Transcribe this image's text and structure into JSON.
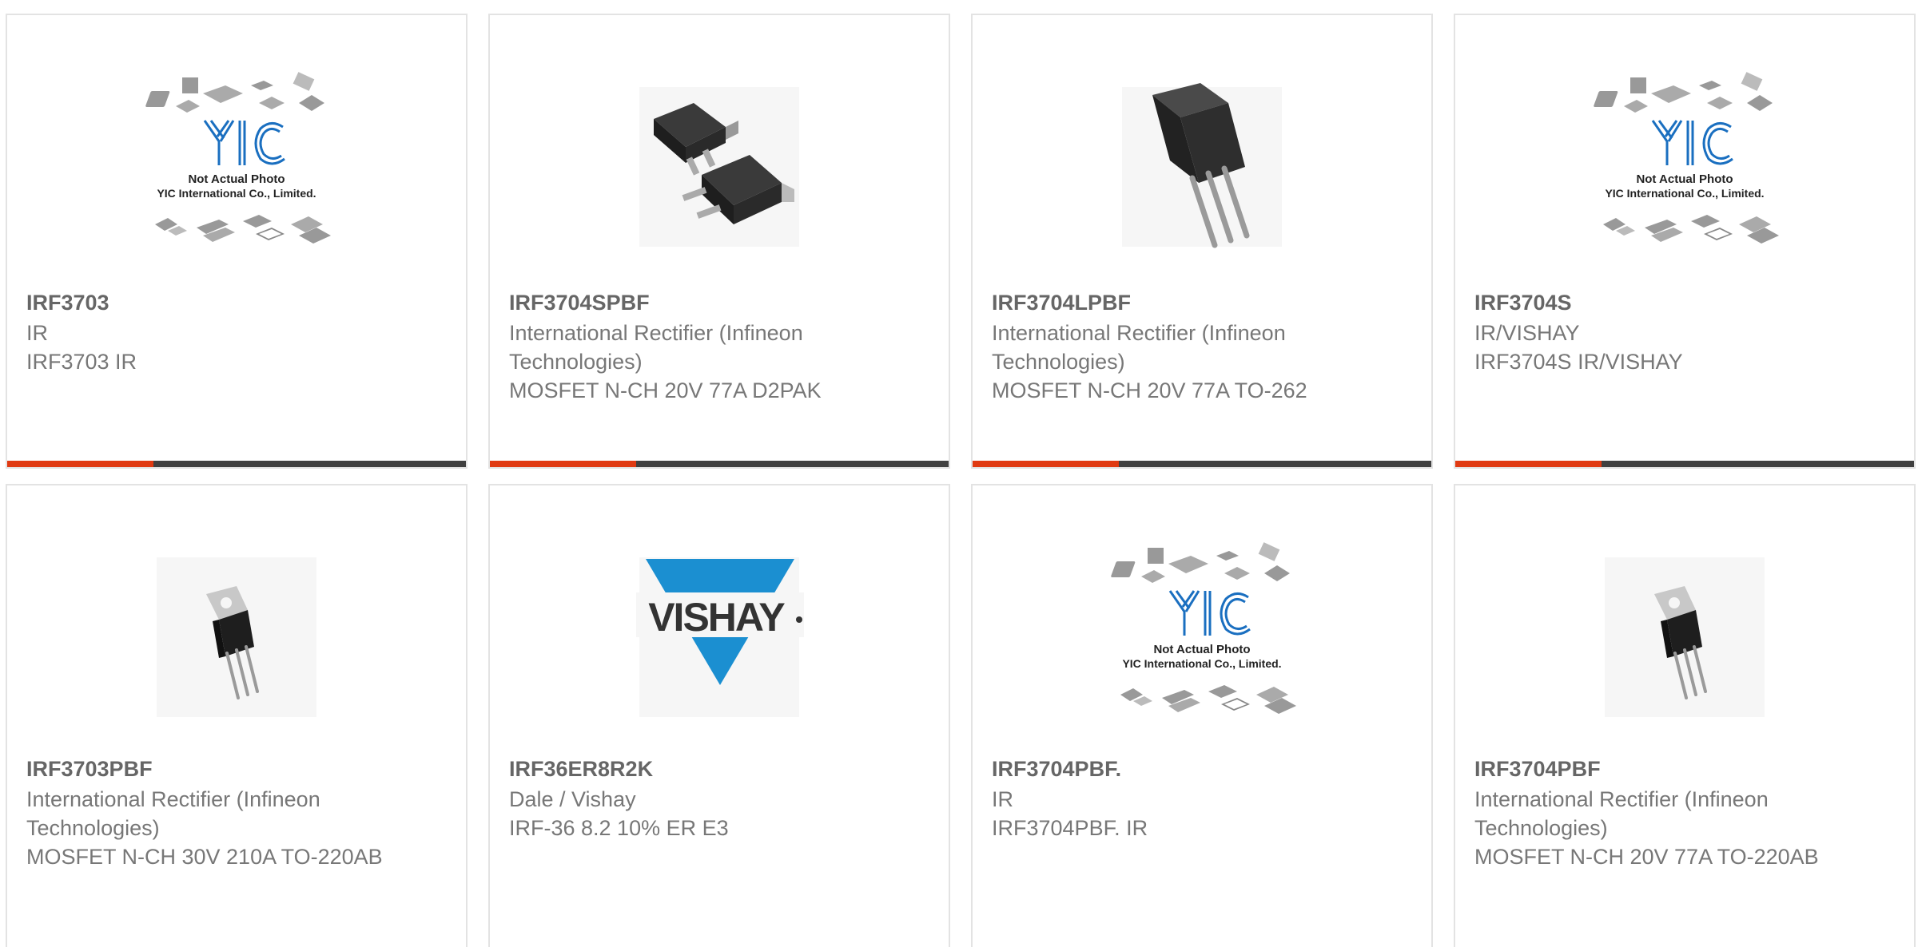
{
  "placeholder": {
    "line1": "Not Actual Photo",
    "line2": "YIC International Co., Limited."
  },
  "vishay_logo_text": "VISHAY",
  "colors": {
    "accent": "#e03a12",
    "bar": "#404040",
    "border": "#e3e3e3",
    "text": "#777777",
    "yic_blue": "#1a6fc0",
    "vishay_blue": "#1b8fd1"
  },
  "products": [
    {
      "part": "IRF3703",
      "manufacturer": "IR",
      "description": "IRF3703 IR",
      "image": "placeholder-icon"
    },
    {
      "part": "IRF3704SPBF",
      "manufacturer": "International Rectifier (Infineon Technologies)",
      "description": "MOSFET N-CH 20V 77A D2PAK",
      "image": "d2pak-package-icon"
    },
    {
      "part": "IRF3704LPBF",
      "manufacturer": "International Rectifier (Infineon Technologies)",
      "description": "MOSFET N-CH 20V 77A TO-262",
      "image": "to262-package-icon"
    },
    {
      "part": "IRF3704S",
      "manufacturer": "IR/VISHAY",
      "description": "IRF3704S IR/VISHAY",
      "image": "placeholder-icon"
    },
    {
      "part": "IRF3703PBF",
      "manufacturer": "International Rectifier (Infineon Technologies)",
      "description": "MOSFET N-CH 30V 210A TO-220AB",
      "image": "to220-package-icon"
    },
    {
      "part": "IRF36ER8R2K",
      "manufacturer": "Dale / Vishay",
      "description": "IRF-36 8.2 10% ER E3",
      "image": "vishay-logo-icon"
    },
    {
      "part": "IRF3704PBF.",
      "manufacturer": "IR",
      "description": "IRF3704PBF. IR",
      "image": "placeholder-icon"
    },
    {
      "part": "IRF3704PBF",
      "manufacturer": "International Rectifier (Infineon Technologies)",
      "description": "MOSFET N-CH 20V 77A TO-220AB",
      "image": "to220-package-icon"
    }
  ]
}
